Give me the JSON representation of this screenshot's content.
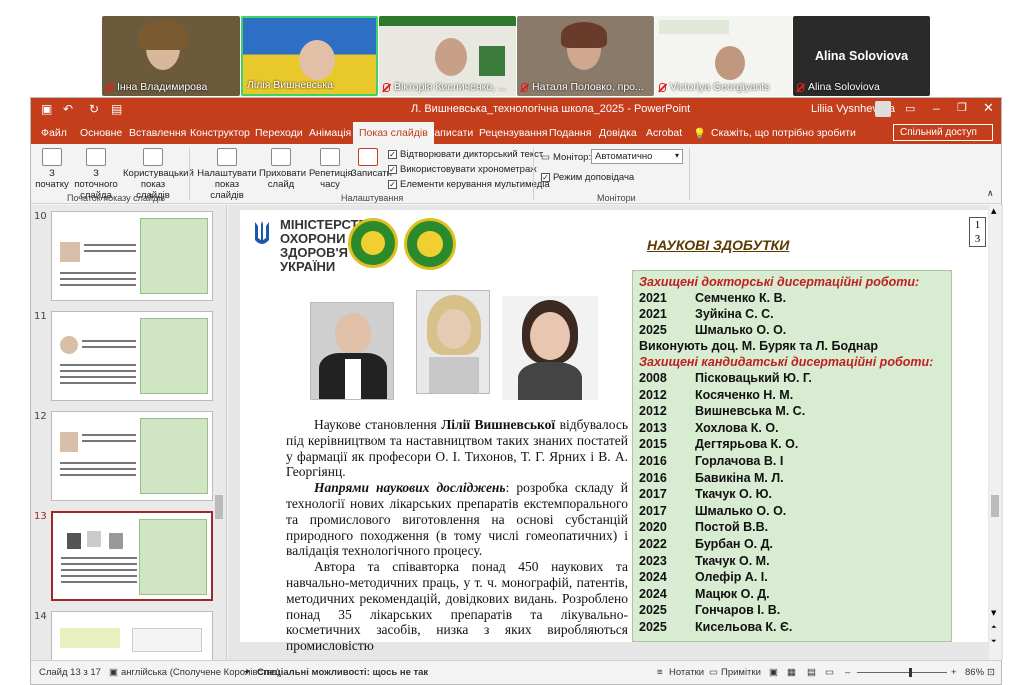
{
  "participants": [
    {
      "name": "Інна Владимирова"
    },
    {
      "name": "Лілія Вишневська"
    },
    {
      "name": "Вікторія Кисличенко, ..."
    },
    {
      "name": "Наталя Половко, про..."
    },
    {
      "name": "Victoriya Georgiyants"
    },
    {
      "name": "Alina Soloviova",
      "big": "Alina Soloviova"
    }
  ],
  "window": {
    "title": "Л. Вишневська_технологічна школа_2025  -  PowerPoint",
    "user": "Liliia Vysnhevska"
  },
  "tabs": [
    "Файл",
    "Основне",
    "Вставлення",
    "Конструктор",
    "Переходи",
    "Анімація",
    "Показ слайдів",
    "Записати",
    "Рецензування",
    "Подання",
    "Довідка",
    "Acrobat"
  ],
  "active_tab": "Показ слайдів",
  "tellme": "Скажіть, що потрібно зробити",
  "share": "Спільний доступ",
  "ribbon": {
    "from_start": "З початку",
    "from_current": "З поточного слайда",
    "custom_show": "Користувацький показ слайдів",
    "group1": "Початок показу слайдів",
    "setup": "Налаштувати показ слайдів",
    "hide": "Приховати слайд",
    "rehearse": "Репетиція часу",
    "record": "Записати",
    "narration": "Відтворювати дикторський текст",
    "timings": "Використовувати хронометраж",
    "media": "Елементи керування мультимедіа",
    "group2": "Налаштування",
    "monitor_label": "Монітор:",
    "monitor_value": "Автоматично",
    "presenter": "Режим доповідача",
    "group3": "Монітори"
  },
  "thumbnails": [
    {
      "num": "10"
    },
    {
      "num": "11"
    },
    {
      "num": "12"
    },
    {
      "num": "13"
    },
    {
      "num": "14"
    }
  ],
  "slide": {
    "number_line1": "1",
    "number_line2": "3",
    "ministry": "МІНІСТЕРСТВО ОХОРОНИ ЗДОРОВ'Я УКРАЇНИ",
    "heading": "НАУКОВІ ЗДОБУТКИ",
    "p1_a": "Наукове становлення ",
    "p1_b": "Лілії Вишневської",
    "p1_c": " відбувалось під керівництвом та наставництвом таких знаних постатей у фармації як професори О. І. Тихонов, Т. Г. Ярних і В. А. Георгіянц.",
    "p2_a": "Напрями наукових досліджень",
    "p2_b": ": розробка складу й технології нових лікарських препаратів екстемпорального та промислового виготовлення на основі субстанцій природного походження (в тому числі гомеопатичних) і валідація технологічного процесу.",
    "p3": "Автора та співавторка понад 450 наукових та навчально-методичних праць, у т. ч. монографій, патентів, методичних рекомендацій, довідкових видань. Розроблено понад 35 лікарських препаратів та лікувально-косметичних засобів, низка з яких виробляються промисловістю",
    "doctoral_title": "Захищені докторські дисертаційні роботи:",
    "doctoral": [
      {
        "year": "2021",
        "name": "Семченко К. В."
      },
      {
        "year": "2021",
        "name": "Зуйкіна С. С."
      },
      {
        "year": "2025",
        "name": "Шмалько О. О."
      }
    ],
    "doctoral_note": "Виконують доц. М. Буряк та Л. Боднар",
    "candidate_title": "Захищені кандидатські дисертаційні роботи:",
    "candidate": [
      {
        "year": "2008",
        "name": "Пісковацький Ю. Г."
      },
      {
        "year": "2012",
        "name": "Косяченко Н. М."
      },
      {
        "year": "2012",
        "name": "Вишневська М. С."
      },
      {
        "year": "2013",
        "name": "Хохлова К. О."
      },
      {
        "year": "2015",
        "name": "Дегтярьова К. О."
      },
      {
        "year": "2016",
        "name": "Горлачова В. І"
      },
      {
        "year": "2016",
        "name": "Бавикіна М. Л."
      },
      {
        "year": "2017",
        "name": "Ткачук О. Ю."
      },
      {
        "year": "2017",
        "name": "Шмалько О. О."
      },
      {
        "year": "2020",
        "name": "Постой В.В."
      },
      {
        "year": "2022",
        "name": "Бурбан О. Д."
      },
      {
        "year": "2023",
        "name": "Ткачук О. М."
      },
      {
        "year": "2024",
        "name": "Олефір А. І."
      },
      {
        "year": "2024",
        "name": "Мацюк О. Д."
      },
      {
        "year": "2025",
        "name": "Гончаров І. В."
      },
      {
        "year": "2025",
        "name": "Кисельова К. Є."
      }
    ]
  },
  "status": {
    "slide": "Слайд 13 з 17",
    "language": "англійська (Сполучене Королівство)",
    "accessibility": "Спеціальні можливості: щось не так",
    "notes": "Нотатки",
    "comments": "Примітки",
    "zoom": "86%"
  },
  "colors": {
    "accent": "#c43e1c",
    "green_box": "#d7ecd0",
    "red_heading": "#c02020"
  }
}
